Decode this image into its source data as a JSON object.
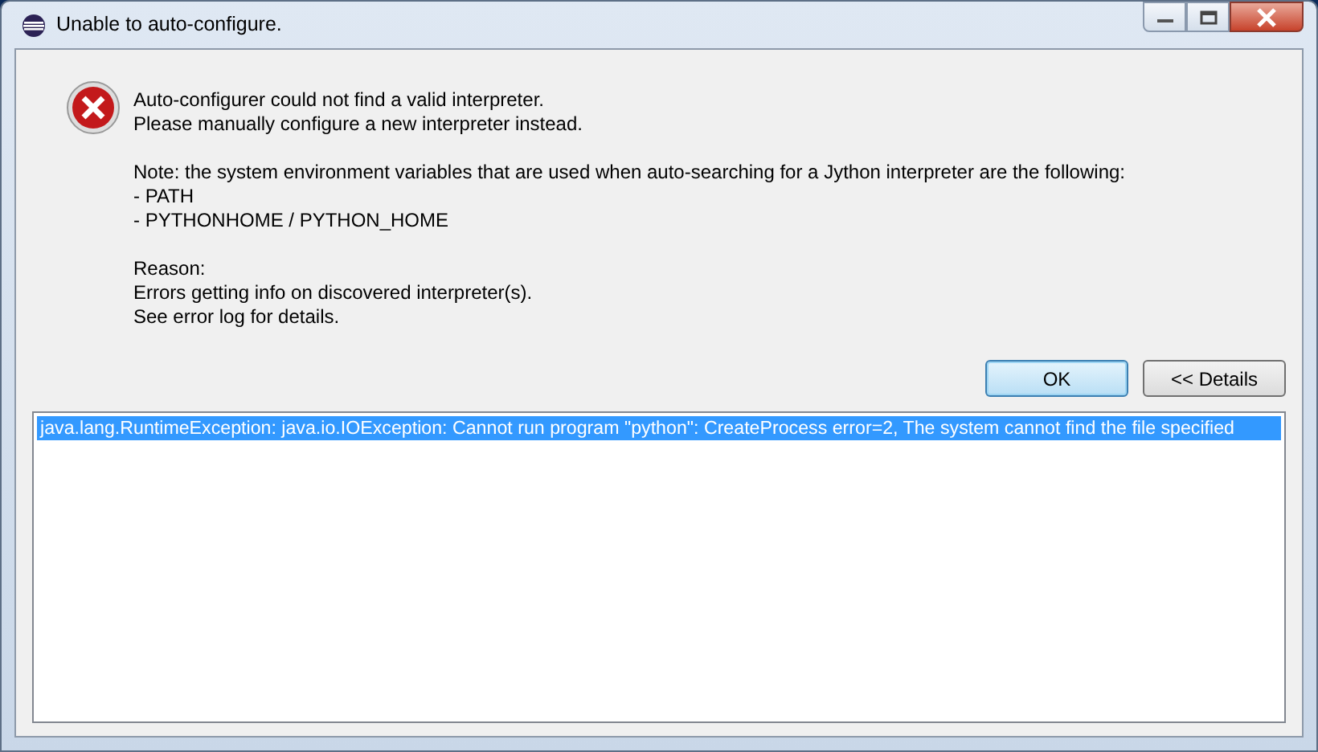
{
  "window": {
    "title": "Unable to auto-configure."
  },
  "message": {
    "kind": "error",
    "paragraphs": [
      [
        "Auto-configurer could not find a valid interpreter.",
        "Please manually configure a new interpreter instead."
      ],
      [
        "Note: the system environment variables that are used when auto-searching for a Jython interpreter are the following:",
        "- PATH",
        "- PYTHONHOME / PYTHON_HOME"
      ],
      [
        "Reason:",
        "Errors getting info on discovered interpreter(s).",
        "See error log for details."
      ]
    ]
  },
  "buttons": [
    {
      "label": "OK",
      "default": true
    },
    {
      "label": "<< Details",
      "default": false
    }
  ],
  "details": [
    {
      "text": "java.lang.RuntimeException: java.io.IOException: Cannot run program \"python\": CreateProcess error=2, The system cannot find the file specified",
      "selected": true
    }
  ]
}
